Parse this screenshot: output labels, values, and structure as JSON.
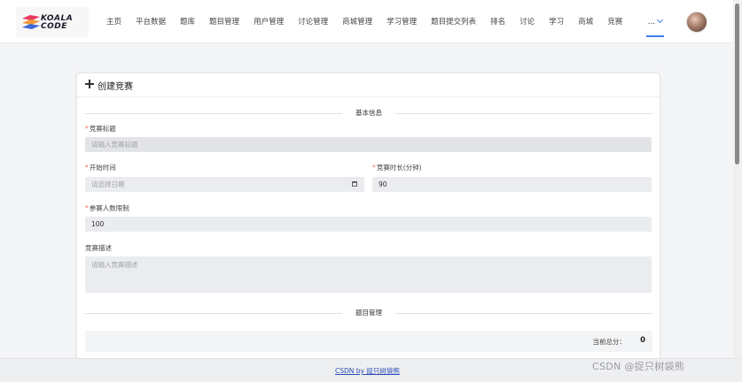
{
  "brand": {
    "line1": "KOALA",
    "line2": "CODE"
  },
  "nav": {
    "items": [
      "主页",
      "平台数据",
      "题库",
      "题目管理",
      "用户管理",
      "讨论管理",
      "商城管理",
      "学习管理",
      "题目提交列表",
      "排名",
      "讨论",
      "学习",
      "商城",
      "竞赛"
    ],
    "more_label": "...",
    "active": "..."
  },
  "card": {
    "title": "创建竞赛",
    "section_basic": "基本信息",
    "section_problems": "题目管理",
    "fields": {
      "title": {
        "label": "竞赛标题",
        "required": "*",
        "placeholder": "请输入竞赛标题",
        "value": ""
      },
      "start_time": {
        "label": "开始时间",
        "required": "*",
        "placeholder": "请选择日期",
        "value": ""
      },
      "duration": {
        "label": "竞赛时长(分钟)",
        "required": "*",
        "value": "90"
      },
      "max_participants": {
        "label": "参赛人数限制",
        "required": "*",
        "value": "100"
      },
      "description": {
        "label": "竞赛描述",
        "placeholder": "请输入竞赛描述",
        "value": ""
      }
    },
    "total_score_label": "当前总分：",
    "total_score": "0"
  },
  "footer": {
    "link": "CSDN by 捉只树袋熊"
  },
  "watermark": "CSDN @捉只树袋熊"
}
